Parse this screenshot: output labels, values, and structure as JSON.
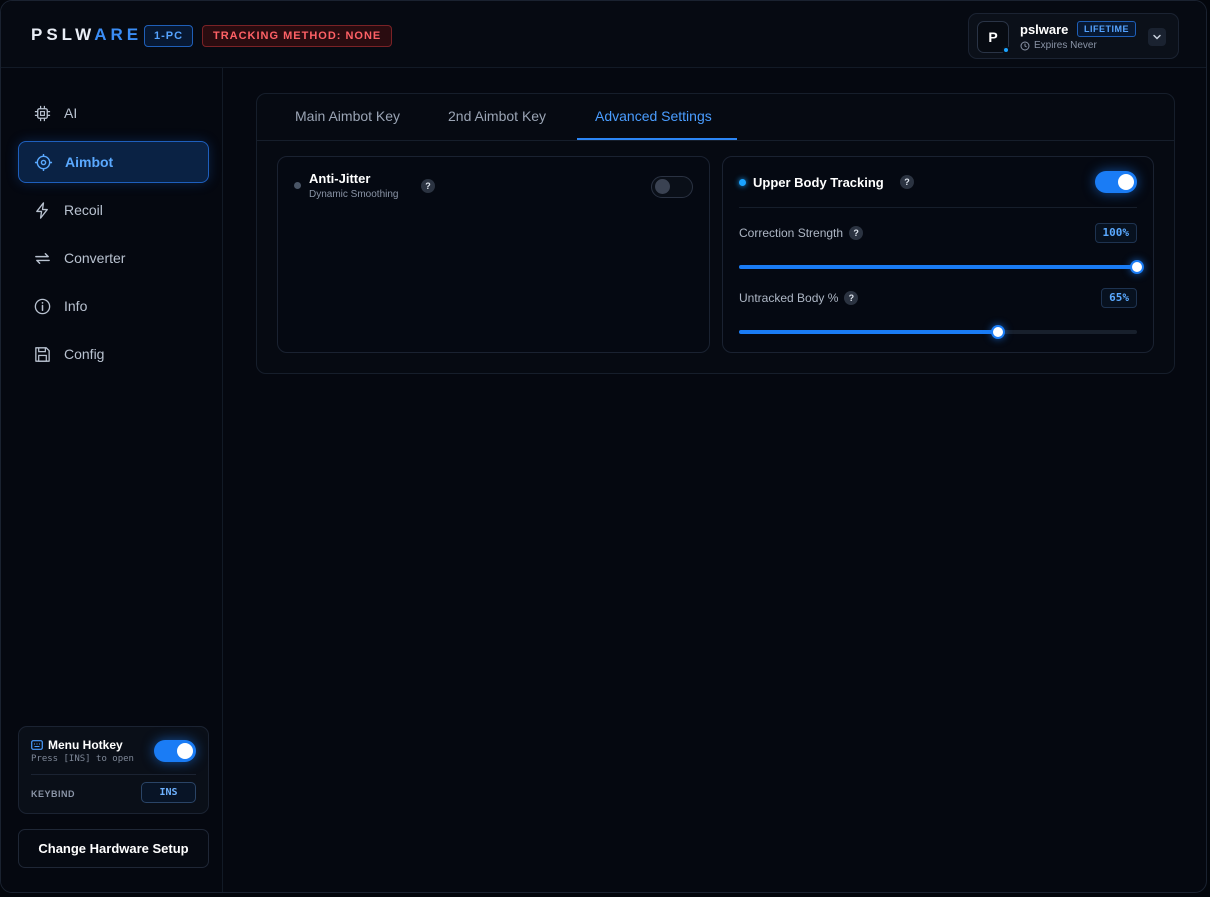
{
  "header": {
    "logo_main": "PSLW",
    "logo_accent": "ARE",
    "pc_badge": "1-PC",
    "tracking_badge": "TRACKING METHOD: NONE",
    "user": {
      "avatar_letter": "P",
      "name": "pslware",
      "plan": "LIFETIME",
      "expires": "Expires Never"
    }
  },
  "sidebar": {
    "items": [
      {
        "label": "AI",
        "icon": "chip-icon",
        "active": false
      },
      {
        "label": "Aimbot",
        "icon": "crosshair-icon",
        "active": true
      },
      {
        "label": "Recoil",
        "icon": "lightning-icon",
        "active": false
      },
      {
        "label": "Converter",
        "icon": "swap-icon",
        "active": false
      },
      {
        "label": "Info",
        "icon": "info-icon",
        "active": false
      },
      {
        "label": "Config",
        "icon": "save-icon",
        "active": false
      }
    ],
    "hotkey": {
      "title": "Menu Hotkey",
      "subtitle": "Press [INS] to open",
      "enabled": true,
      "keybind_label": "KEYBIND",
      "keybind_value": "INS"
    },
    "hardware_button": "Change Hardware Setup"
  },
  "main": {
    "tabs": [
      {
        "label": "Main Aimbot Key",
        "active": false
      },
      {
        "label": "2nd Aimbot Key",
        "active": false
      },
      {
        "label": "Advanced Settings",
        "active": true
      }
    ],
    "anti_jitter": {
      "title": "Anti-Jitter",
      "subtitle": "Dynamic Smoothing",
      "enabled": false
    },
    "upper_body": {
      "title": "Upper Body Tracking",
      "enabled": true,
      "correction_strength": {
        "label": "Correction Strength",
        "value_text": "100%",
        "value": 100
      },
      "untracked_body": {
        "label": "Untracked Body %",
        "value_text": "65%",
        "value": 65
      }
    },
    "help_glyph": "?"
  },
  "colors": {
    "accent": "#1a7cf5",
    "accent_text": "#4a9dff",
    "danger": "#ff6166",
    "background": "#050810"
  }
}
